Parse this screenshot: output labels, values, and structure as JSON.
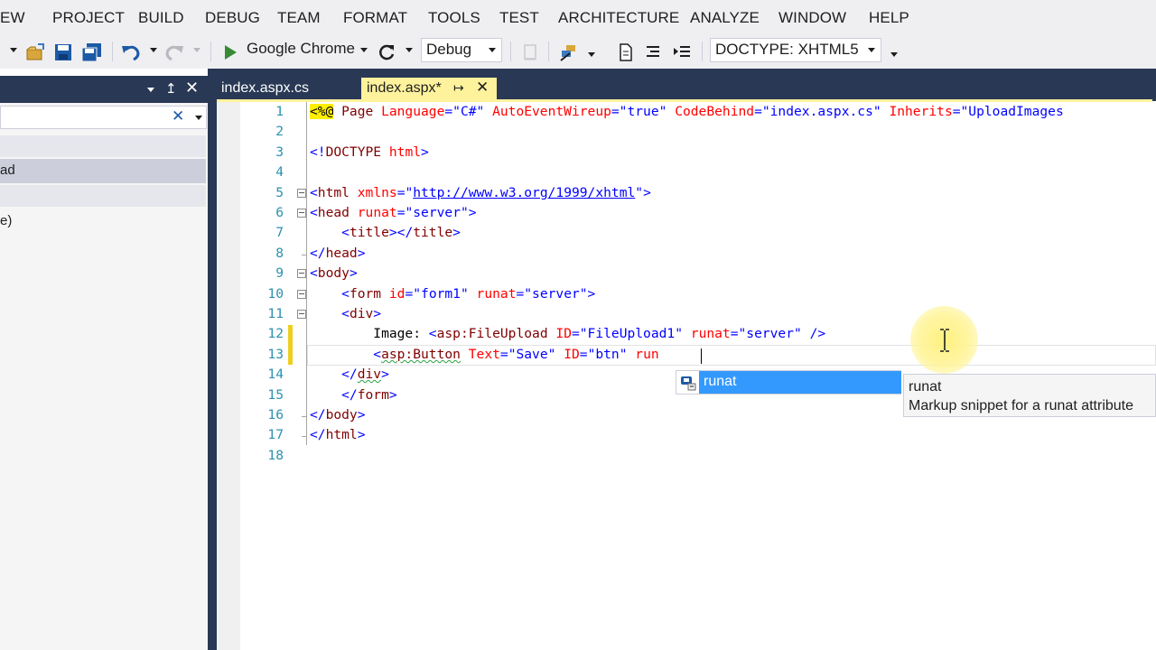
{
  "menu": [
    "EW",
    "PROJECT",
    "BUILD",
    "DEBUG",
    "TEAM",
    "FORMAT",
    "TOOLS",
    "TEST",
    "ARCHITECTURE",
    "ANALYZE",
    "WINDOW",
    "HELP"
  ],
  "toolbar": {
    "browser_label": "Google Chrome",
    "configuration": "Debug",
    "doctype": "DOCTYPE: XHTML5",
    "icons": [
      "open-project-icon",
      "save-icon",
      "save-all-icon",
      "undo-icon",
      "redo-icon",
      "start-debugging-icon",
      "refresh-icon",
      "comment-icon",
      "format-icon",
      "view-icon",
      "outline-icon"
    ]
  },
  "tool_window": {
    "selected_item": "ad",
    "item_2": "e)"
  },
  "tabs": {
    "inactive": "index.aspx.cs",
    "active": "index.aspx*"
  },
  "editor": {
    "line_numbers": [
      "1",
      "2",
      "3",
      "4",
      "5",
      "6",
      "7",
      "8",
      "9",
      "10",
      "11",
      "12",
      "13",
      "14",
      "15",
      "16",
      "17",
      "18"
    ],
    "lines": [
      [
        {
          "t": "<%@",
          "c": "dir"
        },
        {
          "t": " Page ",
          "c": "tag"
        },
        {
          "t": "Language",
          "c": "att"
        },
        {
          "t": "=\"C#\" ",
          "c": "val"
        },
        {
          "t": "AutoEventWireup",
          "c": "att"
        },
        {
          "t": "=\"true\" ",
          "c": "val"
        },
        {
          "t": "CodeBehind",
          "c": "att"
        },
        {
          "t": "=\"index.aspx.cs\" ",
          "c": "val"
        },
        {
          "t": "Inherits",
          "c": "att"
        },
        {
          "t": "=\"UploadImages",
          "c": "val"
        }
      ],
      [],
      [
        {
          "t": "<!",
          "c": "ang"
        },
        {
          "t": "DOCTYPE",
          "c": "tag"
        },
        {
          "t": " ",
          "c": "txt"
        },
        {
          "t": "html",
          "c": "att"
        },
        {
          "t": ">",
          "c": "ang"
        }
      ],
      [],
      [
        {
          "t": "<",
          "c": "ang"
        },
        {
          "t": "html",
          "c": "tag"
        },
        {
          "t": " ",
          "c": "txt"
        },
        {
          "t": "xmlns",
          "c": "att"
        },
        {
          "t": "=\"",
          "c": "val"
        },
        {
          "t": "http://www.w3.org/1999/xhtml",
          "c": "url"
        },
        {
          "t": "\">",
          "c": "val"
        }
      ],
      [
        {
          "t": "<",
          "c": "ang"
        },
        {
          "t": "head",
          "c": "tag"
        },
        {
          "t": " ",
          "c": "txt"
        },
        {
          "t": "runat",
          "c": "att"
        },
        {
          "t": "=\"server\">",
          "c": "val"
        }
      ],
      [
        {
          "t": "    <",
          "c": "ang"
        },
        {
          "t": "title",
          "c": "tag"
        },
        {
          "t": "></",
          "c": "ang"
        },
        {
          "t": "title",
          "c": "tag"
        },
        {
          "t": ">",
          "c": "ang"
        }
      ],
      [
        {
          "t": "</",
          "c": "ang"
        },
        {
          "t": "head",
          "c": "tag"
        },
        {
          "t": ">",
          "c": "ang"
        }
      ],
      [
        {
          "t": "<",
          "c": "ang"
        },
        {
          "t": "body",
          "c": "tag"
        },
        {
          "t": ">",
          "c": "ang"
        }
      ],
      [
        {
          "t": "    <",
          "c": "ang"
        },
        {
          "t": "form",
          "c": "tag"
        },
        {
          "t": " ",
          "c": "txt"
        },
        {
          "t": "id",
          "c": "att"
        },
        {
          "t": "=\"form1\" ",
          "c": "val"
        },
        {
          "t": "runat",
          "c": "att"
        },
        {
          "t": "=\"server\">",
          "c": "val"
        }
      ],
      [
        {
          "t": "    <",
          "c": "ang"
        },
        {
          "t": "div",
          "c": "tag"
        },
        {
          "t": ">",
          "c": "ang"
        }
      ],
      [
        {
          "t": "        Image: ",
          "c": "txt"
        },
        {
          "t": "<",
          "c": "ang"
        },
        {
          "t": "asp:FileUpload",
          "c": "tag"
        },
        {
          "t": " ",
          "c": "txt"
        },
        {
          "t": "ID",
          "c": "att"
        },
        {
          "t": "=\"FileUpload1\" ",
          "c": "val"
        },
        {
          "t": "runat",
          "c": "att"
        },
        {
          "t": "=\"server\" />",
          "c": "val"
        }
      ],
      [
        {
          "t": "        <",
          "c": "ang"
        },
        {
          "t": "asp:Button",
          "c": "tag-squig"
        },
        {
          "t": " ",
          "c": "txt"
        },
        {
          "t": "Text",
          "c": "att"
        },
        {
          "t": "=\"Save\" ",
          "c": "val"
        },
        {
          "t": "ID",
          "c": "att"
        },
        {
          "t": "=\"btn\" ",
          "c": "val"
        },
        {
          "t": "run",
          "c": "att"
        }
      ],
      [
        {
          "t": "    </",
          "c": "ang"
        },
        {
          "t": "div",
          "c": "tag-squig"
        },
        {
          "t": ">",
          "c": "ang"
        }
      ],
      [
        {
          "t": "    </",
          "c": "ang"
        },
        {
          "t": "form",
          "c": "tag"
        },
        {
          "t": ">",
          "c": "ang"
        }
      ],
      [
        {
          "t": "</",
          "c": "ang"
        },
        {
          "t": "body",
          "c": "tag"
        },
        {
          "t": ">",
          "c": "ang"
        }
      ],
      [
        {
          "t": "</",
          "c": "ang"
        },
        {
          "t": "html",
          "c": "tag"
        },
        {
          "t": ">",
          "c": "ang"
        }
      ],
      []
    ]
  },
  "intellisense": {
    "item": "runat",
    "tooltip_title": "runat",
    "tooltip_desc": "Markup snippet for a runat attribute"
  },
  "colors": {
    "tab_active": "#fff29d",
    "chrome_dark": "#293955",
    "selection": "#3399ff"
  }
}
